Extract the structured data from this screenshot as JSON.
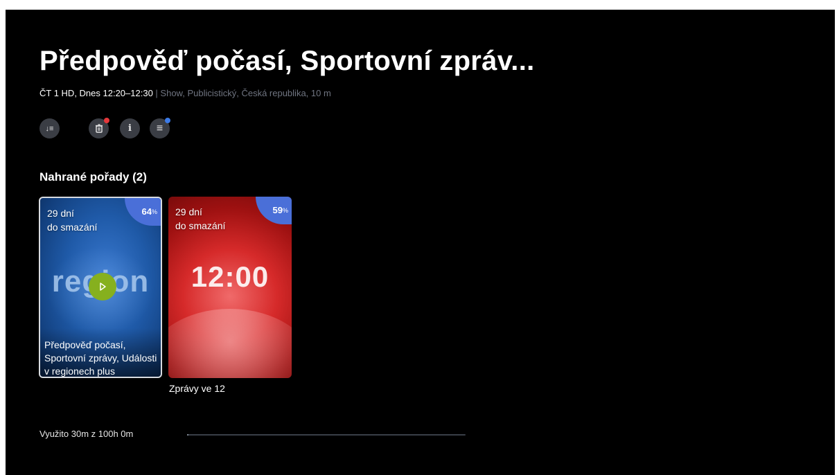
{
  "program": {
    "title": "Předpověď počasí, Sportovní zpráv...",
    "meta_primary": "ČT 1 HD, Dnes 12:20–12:30",
    "meta_secondary": " | Show, Publicistický, Česká republika, 10 m"
  },
  "actions": [
    {
      "icon": "sort-icon",
      "glyph": "↓≡"
    },
    {
      "icon": "trash-icon",
      "glyph": "🗑",
      "dot_color": "#e5383b"
    },
    {
      "icon": "info-icon",
      "glyph": "i"
    },
    {
      "icon": "menu-icon",
      "glyph": "≡",
      "dot_color": "#3c7be8"
    }
  ],
  "recordings": {
    "heading": "Nahrané pořady (2)",
    "items": [
      {
        "days_line1": "29 dní",
        "days_line2": "do smazání",
        "percent": "64",
        "percent_sign": "%",
        "logo": "region",
        "title": "Předpověď počasí, Sportovní zprávy, Události v regionech plus"
      },
      {
        "days_line1": "29 dní",
        "days_line2": "do smazání",
        "percent": "59",
        "percent_sign": "%",
        "logo": "12:00",
        "title": "Zprávy ve 12"
      }
    ]
  },
  "storage": {
    "label": "Využito 30m z 100h 0m",
    "used_fraction": 0.005
  },
  "colors": {
    "background": "#000000",
    "badge": "#4a6fd8",
    "play": "#86b01e"
  }
}
